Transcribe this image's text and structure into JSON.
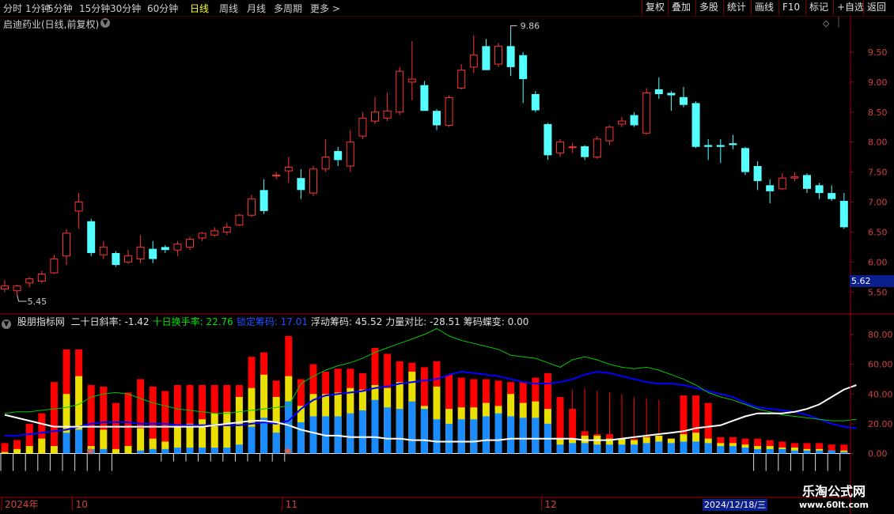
{
  "toolbar": {
    "periods": [
      "分时",
      "1分钟",
      "5分钟",
      "15分钟",
      "30分钟",
      "60分钟",
      "日线",
      "周线",
      "月线",
      "多周期",
      "更多 >"
    ],
    "active_period": "日线",
    "buttons": [
      "复权",
      "叠加",
      "多股",
      "统计",
      "画线",
      "F10",
      "标记",
      "+自选",
      "返回"
    ]
  },
  "stock": {
    "title": "启迪药业(日线,前复权)"
  },
  "price_panel": {
    "high_label": "9.86",
    "low_label": "5.45",
    "current_price": "5.62"
  },
  "indicator_bar": {
    "name": "股朋指标网",
    "items": [
      {
        "label": "二十日斜率:",
        "value": "-1.42",
        "color": "#e0e0e0"
      },
      {
        "label": "十日换手率:",
        "value": "22.76",
        "color": "#00e000"
      },
      {
        "label": "锁定筹码:",
        "value": "17.01",
        "color": "#2050ff"
      },
      {
        "label": "浮动筹码:",
        "value": "45.52",
        "color": "#e0e0e0"
      },
      {
        "label": "力量对比:",
        "value": "-28.51",
        "color": "#e0e0e0"
      },
      {
        "label": "筹码蝶变:",
        "value": "0.00",
        "color": "#e0e0e0"
      }
    ]
  },
  "bottom_axis": {
    "labels": [
      {
        "text": "2024年",
        "index": 0
      },
      {
        "text": "10",
        "index": 6
      },
      {
        "text": "11",
        "index": 23
      },
      {
        "text": "12",
        "index": 44
      }
    ],
    "cursor_date": "2024/12/18/三"
  },
  "watermark": {
    "line1": "乐淘公式网",
    "line2": "www.60lt.com"
  },
  "colors": {
    "up": "#ff3232",
    "down": "#54ffff",
    "axis_red": "#a00000",
    "yellow": "#e8e000",
    "blue": "#1a8cff",
    "green_line": "#00c800",
    "blue_line": "#0000ff",
    "white_line": "#ffffff"
  },
  "chart_data": [
    {
      "type": "candlestick",
      "ylim": [
        5.2,
        10.0
      ],
      "y_ticks": [
        5.5,
        6.0,
        6.5,
        7.0,
        7.5,
        8.0,
        8.5,
        9.0,
        9.5
      ],
      "x_labels": [
        "2024年",
        "10",
        "11",
        "12"
      ],
      "candles": [
        {
          "o": 5.55,
          "h": 5.7,
          "l": 5.5,
          "c": 5.6
        },
        {
          "o": 5.52,
          "h": 5.62,
          "l": 5.45,
          "c": 5.6
        },
        {
          "o": 5.65,
          "h": 5.75,
          "l": 5.58,
          "c": 5.72
        },
        {
          "o": 5.68,
          "h": 5.85,
          "l": 5.65,
          "c": 5.8
        },
        {
          "o": 5.82,
          "h": 6.12,
          "l": 5.8,
          "c": 6.05
        },
        {
          "o": 6.1,
          "h": 6.55,
          "l": 5.95,
          "c": 6.48
        },
        {
          "o": 6.85,
          "h": 7.15,
          "l": 6.55,
          "c": 7.0
        },
        {
          "o": 6.68,
          "h": 6.72,
          "l": 6.1,
          "c": 6.15
        },
        {
          "o": 6.12,
          "h": 6.35,
          "l": 6.05,
          "c": 6.25
        },
        {
          "o": 6.15,
          "h": 6.18,
          "l": 5.92,
          "c": 5.95
        },
        {
          "o": 6.0,
          "h": 6.2,
          "l": 5.97,
          "c": 6.1
        },
        {
          "o": 6.05,
          "h": 6.45,
          "l": 5.98,
          "c": 6.25
        },
        {
          "o": 6.22,
          "h": 6.35,
          "l": 5.98,
          "c": 6.05
        },
        {
          "o": 6.25,
          "h": 6.28,
          "l": 6.15,
          "c": 6.2
        },
        {
          "o": 6.2,
          "h": 6.35,
          "l": 6.1,
          "c": 6.3
        },
        {
          "o": 6.25,
          "h": 6.42,
          "l": 6.2,
          "c": 6.38
        },
        {
          "o": 6.4,
          "h": 6.5,
          "l": 6.35,
          "c": 6.48
        },
        {
          "o": 6.45,
          "h": 6.58,
          "l": 6.42,
          "c": 6.52
        },
        {
          "o": 6.5,
          "h": 6.65,
          "l": 6.45,
          "c": 6.58
        },
        {
          "o": 6.62,
          "h": 6.8,
          "l": 6.6,
          "c": 6.78
        },
        {
          "o": 6.78,
          "h": 7.12,
          "l": 6.75,
          "c": 7.05
        },
        {
          "o": 7.2,
          "h": 7.38,
          "l": 6.8,
          "c": 6.85
        },
        {
          "o": 7.45,
          "h": 7.5,
          "l": 7.38,
          "c": 7.45
        },
        {
          "o": 7.52,
          "h": 7.75,
          "l": 7.32,
          "c": 7.58
        },
        {
          "o": 7.4,
          "h": 7.55,
          "l": 7.05,
          "c": 7.2
        },
        {
          "o": 7.15,
          "h": 7.6,
          "l": 7.1,
          "c": 7.55
        },
        {
          "o": 7.55,
          "h": 8.05,
          "l": 7.5,
          "c": 7.75
        },
        {
          "o": 7.85,
          "h": 7.92,
          "l": 7.6,
          "c": 7.7
        },
        {
          "o": 7.6,
          "h": 8.2,
          "l": 7.5,
          "c": 8.0
        },
        {
          "o": 8.1,
          "h": 8.5,
          "l": 8.05,
          "c": 8.4
        },
        {
          "o": 8.35,
          "h": 8.75,
          "l": 8.3,
          "c": 8.5
        },
        {
          "o": 8.4,
          "h": 8.82,
          "l": 8.35,
          "c": 8.52
        },
        {
          "o": 8.5,
          "h": 9.25,
          "l": 8.45,
          "c": 9.18
        },
        {
          "o": 9.0,
          "h": 9.68,
          "l": 8.7,
          "c": 9.05
        },
        {
          "o": 8.95,
          "h": 9.02,
          "l": 8.52,
          "c": 8.52
        },
        {
          "o": 8.52,
          "h": 8.55,
          "l": 8.2,
          "c": 8.28
        },
        {
          "o": 8.28,
          "h": 8.78,
          "l": 8.25,
          "c": 8.74
        },
        {
          "o": 8.9,
          "h": 9.3,
          "l": 8.88,
          "c": 9.2
        },
        {
          "o": 9.25,
          "h": 9.78,
          "l": 9.15,
          "c": 9.45
        },
        {
          "o": 9.6,
          "h": 9.72,
          "l": 9.22,
          "c": 9.2
        },
        {
          "o": 9.3,
          "h": 9.65,
          "l": 9.25,
          "c": 9.6
        },
        {
          "o": 9.6,
          "h": 9.86,
          "l": 9.1,
          "c": 9.25
        },
        {
          "o": 9.45,
          "h": 9.5,
          "l": 8.65,
          "c": 9.05
        },
        {
          "o": 8.8,
          "h": 8.85,
          "l": 8.5,
          "c": 8.53
        },
        {
          "o": 8.3,
          "h": 8.32,
          "l": 7.7,
          "c": 7.78
        },
        {
          "o": 7.82,
          "h": 8.05,
          "l": 7.75,
          "c": 8.0
        },
        {
          "o": 7.92,
          "h": 7.98,
          "l": 7.82,
          "c": 7.92
        },
        {
          "o": 7.93,
          "h": 7.95,
          "l": 7.7,
          "c": 7.75
        },
        {
          "o": 7.75,
          "h": 8.1,
          "l": 7.72,
          "c": 8.05
        },
        {
          "o": 8.02,
          "h": 8.28,
          "l": 7.95,
          "c": 8.25
        },
        {
          "o": 8.3,
          "h": 8.42,
          "l": 8.25,
          "c": 8.35
        },
        {
          "o": 8.45,
          "h": 8.5,
          "l": 8.25,
          "c": 8.28
        },
        {
          "o": 8.15,
          "h": 8.9,
          "l": 8.12,
          "c": 8.82
        },
        {
          "o": 8.88,
          "h": 9.08,
          "l": 8.72,
          "c": 8.8
        },
        {
          "o": 8.82,
          "h": 8.85,
          "l": 8.52,
          "c": 8.78
        },
        {
          "o": 8.75,
          "h": 8.92,
          "l": 8.58,
          "c": 8.62
        },
        {
          "o": 8.65,
          "h": 8.68,
          "l": 7.9,
          "c": 7.92
        },
        {
          "o": 7.95,
          "h": 8.05,
          "l": 7.7,
          "c": 7.92
        },
        {
          "o": 7.95,
          "h": 8.05,
          "l": 7.65,
          "c": 7.92
        },
        {
          "o": 7.98,
          "h": 8.12,
          "l": 7.88,
          "c": 7.95
        },
        {
          "o": 7.9,
          "h": 7.92,
          "l": 7.45,
          "c": 7.5
        },
        {
          "o": 7.6,
          "h": 7.68,
          "l": 7.2,
          "c": 7.35
        },
        {
          "o": 7.28,
          "h": 7.38,
          "l": 6.98,
          "c": 7.18
        },
        {
          "o": 7.22,
          "h": 7.48,
          "l": 7.2,
          "c": 7.4
        },
        {
          "o": 7.4,
          "h": 7.5,
          "l": 7.35,
          "c": 7.42
        },
        {
          "o": 7.45,
          "h": 7.48,
          "l": 7.15,
          "c": 7.22
        },
        {
          "o": 7.28,
          "h": 7.32,
          "l": 7.05,
          "c": 7.15
        },
        {
          "o": 7.15,
          "h": 7.28,
          "l": 7.02,
          "c": 7.05
        },
        {
          "o": 7.02,
          "h": 7.15,
          "l": 6.55,
          "c": 6.58
        }
      ]
    },
    {
      "type": "bar",
      "ylim": [
        -15,
        95
      ],
      "y_ticks": [
        0.0,
        20.0,
        40.0,
        60.0,
        80.0
      ],
      "series": [
        {
          "name": "锁定筹码",
          "style": "line",
          "color": "#0000ff",
          "values": [
            12,
            12,
            13,
            14,
            15,
            16,
            18,
            20,
            21,
            21,
            21,
            20,
            20,
            20,
            19,
            19,
            19,
            19,
            19,
            19,
            20,
            21,
            20,
            22,
            30,
            36,
            39,
            40,
            41,
            42,
            44,
            45,
            47,
            48,
            49,
            50,
            53,
            55,
            54,
            53,
            52,
            50,
            48,
            47,
            47,
            48,
            50,
            53,
            55,
            54,
            52,
            50,
            48,
            47,
            47,
            46,
            44,
            42,
            40,
            38,
            34,
            31,
            30,
            29,
            28,
            26,
            23,
            20,
            18,
            17
          ]
        },
        {
          "name": "十日换手率",
          "style": "line",
          "color": "#00c800",
          "values": [
            27,
            28,
            28,
            29,
            30,
            31,
            33,
            38,
            40,
            41,
            40,
            37,
            34,
            32,
            30,
            29,
            28,
            27,
            27,
            28,
            29,
            30,
            31,
            32,
            47,
            52,
            56,
            59,
            61,
            64,
            68,
            71,
            74,
            77,
            80,
            84,
            79,
            76,
            74,
            72,
            70,
            66,
            65,
            64,
            61,
            58,
            63,
            65,
            63,
            60,
            58,
            57,
            58,
            56,
            53,
            50,
            46,
            41,
            38,
            36,
            33,
            30,
            28,
            26,
            25,
            24,
            23,
            22,
            22,
            23
          ]
        },
        {
          "name": "white",
          "style": "line",
          "color": "#ffffff",
          "values": [
            26,
            24,
            22,
            20,
            18,
            18,
            18,
            18,
            18,
            18,
            18,
            18,
            18,
            18,
            18,
            18,
            18,
            19,
            20,
            21,
            22,
            22,
            21,
            19,
            16,
            14,
            12,
            12,
            11,
            11,
            11,
            10,
            10,
            9,
            9,
            8,
            8,
            8,
            8,
            9,
            9,
            10,
            10,
            10,
            10,
            10,
            10,
            9,
            9,
            9,
            10,
            11,
            12,
            13,
            14,
            15,
            17,
            18,
            19,
            22,
            25,
            27,
            27,
            27,
            28,
            30,
            33,
            38,
            43,
            46
          ]
        },
        {
          "name": "浮动筹码",
          "style": "bar",
          "color": "#ff0000",
          "values": [
            7,
            9,
            20,
            27,
            48,
            70,
            70,
            46,
            45,
            34,
            41,
            50,
            45,
            42,
            46,
            46,
            46,
            46,
            46,
            46,
            65,
            68,
            49,
            79,
            50,
            60,
            55,
            57,
            57,
            54,
            71,
            67,
            62,
            61,
            58,
            62,
            53,
            51,
            50,
            50,
            49,
            48,
            48,
            51,
            54,
            38,
            30,
            15,
            13,
            13,
            10,
            10,
            12,
            12,
            10,
            39,
            39,
            34,
            11,
            11,
            10,
            10,
            9,
            8,
            7,
            7,
            7,
            6,
            6,
            5
          ]
        },
        {
          "name": "yellow",
          "style": "bar",
          "color": "#e8e000",
          "values": [
            1,
            3,
            5,
            10,
            5,
            40,
            52,
            5,
            16,
            3,
            5,
            17,
            10,
            8,
            18,
            20,
            23,
            27,
            28,
            38,
            44,
            53,
            38,
            52,
            32,
            40,
            40,
            41,
            44,
            43,
            46,
            44,
            48,
            55,
            32,
            45,
            30,
            31,
            31,
            34,
            32,
            40,
            34,
            35,
            30,
            10,
            10,
            12,
            12,
            10,
            10,
            9,
            11,
            12,
            10,
            13,
            14,
            10,
            7,
            7,
            6,
            5,
            5,
            4,
            4,
            3,
            3,
            2,
            2,
            2
          ]
        },
        {
          "name": "blue",
          "style": "bar",
          "color": "#1a8cff",
          "values": [
            0,
            0,
            0,
            0,
            0,
            14,
            16,
            3,
            3,
            0,
            0,
            2,
            3,
            3,
            4,
            4,
            4,
            4,
            4,
            6,
            18,
            24,
            14,
            35,
            21,
            25,
            25,
            25,
            27,
            29,
            36,
            31,
            30,
            35,
            30,
            23,
            20,
            23,
            23,
            25,
            27,
            25,
            24,
            24,
            20,
            6,
            7,
            7,
            6,
            6,
            6,
            6,
            7,
            8,
            7,
            8,
            8,
            7,
            5,
            5,
            4,
            3,
            3,
            3,
            2,
            2,
            2,
            2,
            1,
            1
          ]
        },
        {
          "name": "筹码蝶变",
          "style": "marker",
          "color": "#ff4020",
          "indices": [
            7,
            23
          ]
        }
      ]
    }
  ]
}
